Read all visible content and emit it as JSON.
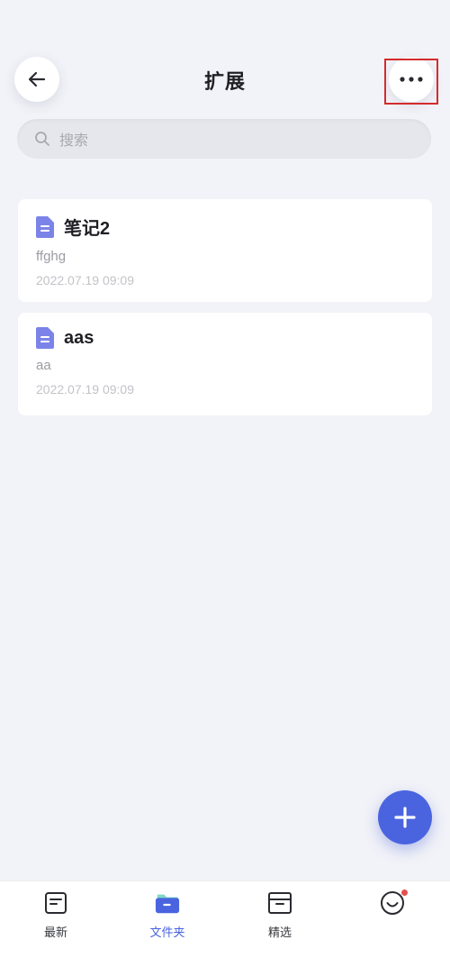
{
  "header": {
    "title": "扩展"
  },
  "search": {
    "placeholder": "搜索"
  },
  "notes": [
    {
      "title": "笔记2",
      "snippet": "ffghg",
      "date": "2022.07.19 09:09"
    },
    {
      "title": "aas",
      "snippet": "aa",
      "date": "2022.07.19 09:09"
    }
  ],
  "bottom_nav": {
    "items": [
      {
        "label": "最新",
        "icon": "note-list-icon",
        "active": false
      },
      {
        "label": "文件夹",
        "icon": "folder-icon",
        "active": true
      },
      {
        "label": "精选",
        "icon": "archive-box-icon",
        "active": false
      },
      {
        "label": "",
        "icon": "smiley-face-icon",
        "active": false,
        "badge": true
      }
    ]
  },
  "colors": {
    "accent": "#4a64e0",
    "background": "#f2f3f8",
    "highlight_border": "#d42b2b",
    "badge": "#e25050"
  }
}
